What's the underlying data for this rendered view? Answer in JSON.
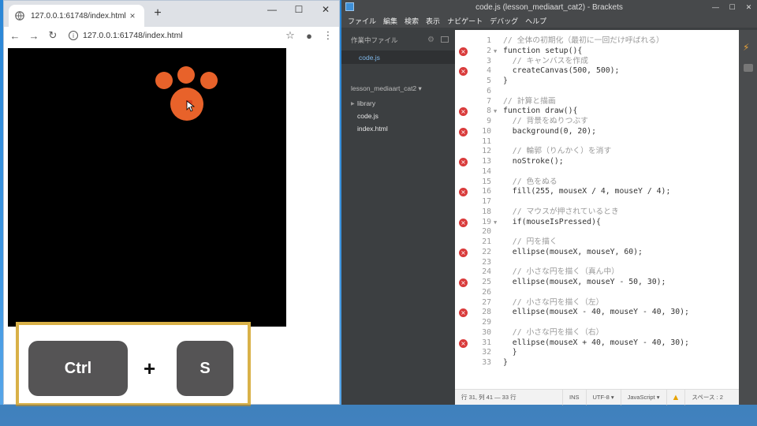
{
  "chrome": {
    "tab_title": "127.0.0.1:61748/index.html",
    "tab_close": "×",
    "new_tab": "+",
    "minimize": "—",
    "maximize": "☐",
    "close": "✕",
    "back": "←",
    "forward": "→",
    "reload": "↻",
    "url": "127.0.0.1:61748/index.html",
    "info": "i",
    "bookmark": "☆",
    "profile": "●",
    "menu": "⋮"
  },
  "shortcut": {
    "key1": "Ctrl",
    "plus": "+",
    "key2": "S"
  },
  "brackets": {
    "title": "code.js (lesson_mediaart_cat2) - Brackets",
    "minimize": "—",
    "maximize": "☐",
    "close": "✕",
    "menu": [
      "ファイル",
      "編集",
      "検索",
      "表示",
      "ナビゲート",
      "デバッグ",
      "ヘルプ"
    ],
    "sidebar": {
      "working_files_header": "作業中ファイル",
      "working_file": "code.js",
      "project_name": "lesson_mediaart_cat2 ▾",
      "folder_library": "library",
      "file_code": "code.js",
      "file_index": "index.html"
    },
    "code_lines": [
      {
        "n": "1",
        "t": "// 全体の初期化（最初に一回だけ呼ばれる）",
        "err": false,
        "fold": "",
        "c": true
      },
      {
        "n": "2",
        "t": "function setup(){",
        "err": true,
        "fold": "▼",
        "c": false
      },
      {
        "n": "3",
        "t": "  // キャンバスを作成",
        "err": false,
        "fold": "",
        "c": true
      },
      {
        "n": "4",
        "t": "  createCanvas(500, 500);",
        "err": true,
        "fold": "",
        "c": false
      },
      {
        "n": "5",
        "t": "}",
        "err": false,
        "fold": "",
        "c": false
      },
      {
        "n": "6",
        "t": "",
        "err": false,
        "fold": "",
        "c": false
      },
      {
        "n": "7",
        "t": "// 計算と描画",
        "err": false,
        "fold": "",
        "c": true
      },
      {
        "n": "8",
        "t": "function draw(){",
        "err": true,
        "fold": "▼",
        "c": false
      },
      {
        "n": "9",
        "t": "  // 背景をぬりつぶす",
        "err": false,
        "fold": "",
        "c": true
      },
      {
        "n": "10",
        "t": "  background(0, 20);",
        "err": true,
        "fold": "",
        "c": false
      },
      {
        "n": "11",
        "t": "",
        "err": false,
        "fold": "",
        "c": false
      },
      {
        "n": "12",
        "t": "  // 輪郭（りんかく）を消す",
        "err": false,
        "fold": "",
        "c": true
      },
      {
        "n": "13",
        "t": "  noStroke();",
        "err": true,
        "fold": "",
        "c": false
      },
      {
        "n": "14",
        "t": "",
        "err": false,
        "fold": "",
        "c": false
      },
      {
        "n": "15",
        "t": "  // 色をぬる",
        "err": false,
        "fold": "",
        "c": true
      },
      {
        "n": "16",
        "t": "  fill(255, mouseX / 4, mouseY / 4);",
        "err": true,
        "fold": "",
        "c": false
      },
      {
        "n": "17",
        "t": "",
        "err": false,
        "fold": "",
        "c": false
      },
      {
        "n": "18",
        "t": "  // マウスが押されているとき",
        "err": false,
        "fold": "",
        "c": true
      },
      {
        "n": "19",
        "t": "  if(mouseIsPressed){",
        "err": true,
        "fold": "▼",
        "c": false
      },
      {
        "n": "20",
        "t": "",
        "err": false,
        "fold": "",
        "c": false
      },
      {
        "n": "21",
        "t": "  // 円を描く",
        "err": false,
        "fold": "",
        "c": true
      },
      {
        "n": "22",
        "t": "  ellipse(mouseX, mouseY, 60);",
        "err": true,
        "fold": "",
        "c": false
      },
      {
        "n": "23",
        "t": "",
        "err": false,
        "fold": "",
        "c": false
      },
      {
        "n": "24",
        "t": "  // 小さな円を描く（真ん中）",
        "err": false,
        "fold": "",
        "c": true
      },
      {
        "n": "25",
        "t": "  ellipse(mouseX, mouseY - 50, 30);",
        "err": true,
        "fold": "",
        "c": false
      },
      {
        "n": "26",
        "t": "",
        "err": false,
        "fold": "",
        "c": false
      },
      {
        "n": "27",
        "t": "  // 小さな円を描く（左）",
        "err": false,
        "fold": "",
        "c": true
      },
      {
        "n": "28",
        "t": "  ellipse(mouseX - 40, mouseY - 40, 30);",
        "err": true,
        "fold": "",
        "c": false
      },
      {
        "n": "29",
        "t": "",
        "err": false,
        "fold": "",
        "c": false
      },
      {
        "n": "30",
        "t": "  // 小さな円を描く（右）",
        "err": false,
        "fold": "",
        "c": true
      },
      {
        "n": "31",
        "t": "  ellipse(mouseX + 40, mouseY - 40, 30);",
        "err": true,
        "fold": "",
        "c": false
      },
      {
        "n": "32",
        "t": "  }",
        "err": false,
        "fold": "",
        "c": false
      },
      {
        "n": "33",
        "t": "}",
        "err": false,
        "fold": "",
        "c": false
      }
    ],
    "status": {
      "position": "行 31, 列 41 — 33 行",
      "ins": "INS",
      "encoding": "UTF-8 ▾",
      "language": "JavaScript ▾",
      "warning": "▲",
      "spaces": "スペース : 2"
    },
    "colors": {
      "error_marker": "#d93b3b",
      "paw": "#e8622a",
      "shortcut_border": "#d9b148"
    }
  }
}
